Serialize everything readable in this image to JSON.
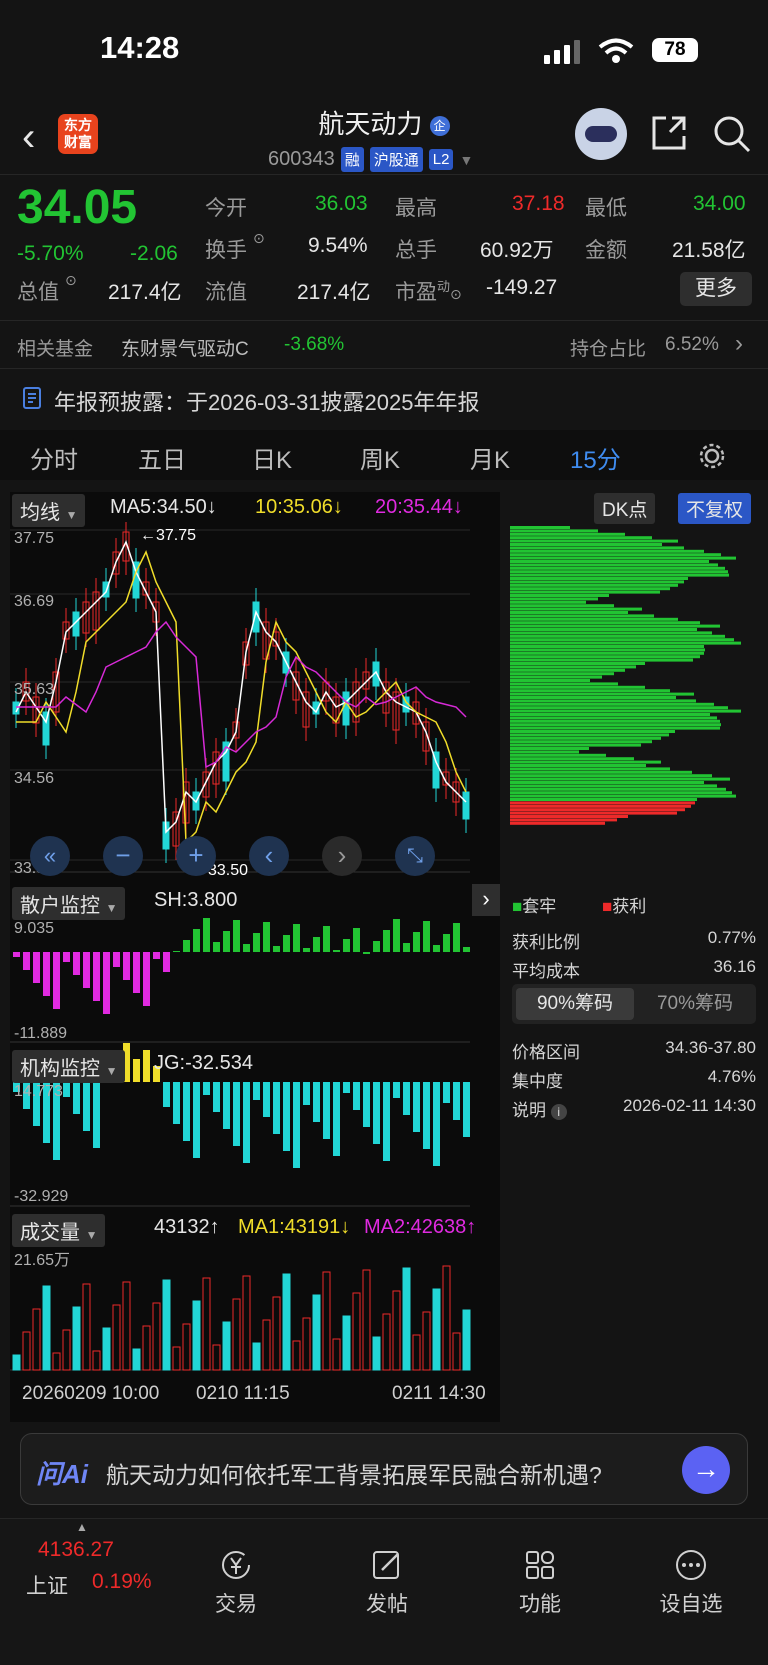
{
  "status": {
    "time": "14:28",
    "battery": "78"
  },
  "header": {
    "logo_text": "东方财富",
    "title": "航天动力",
    "title_badge": "企",
    "code": "600343",
    "tags": [
      "融",
      "沪股通",
      "L2"
    ]
  },
  "quote": {
    "price": "34.05",
    "change_pct": "-5.70%",
    "change": "-2.06",
    "open_label": "今开",
    "open": "36.03",
    "high_label": "最高",
    "high": "37.18",
    "low_label": "最低",
    "low": "34.00",
    "turnover_label": "换手",
    "turnover": "9.54%",
    "volume_label": "总手",
    "volume": "60.92万",
    "amount_label": "金额",
    "amount": "21.58亿",
    "mktcap_label": "总值",
    "mktcap": "217.4亿",
    "float_label": "流值",
    "float": "217.4亿",
    "pe_label": "市盈",
    "pe_sup": "动",
    "pe": "-149.27",
    "more": "更多"
  },
  "fund": {
    "label": "相关基金",
    "name": "东财景气驱动C",
    "change": "-3.68%",
    "hold_label": "持仓占比",
    "hold": "6.52%"
  },
  "notice": "年报预披露：于2026-03-31披露2025年年报",
  "tabs": [
    "分时",
    "五日",
    "日K",
    "周K",
    "月K",
    "15分"
  ],
  "active_tab": "15分",
  "chart": {
    "ma_selector": "均线",
    "ma5": "MA5:34.50",
    "ma10": "10:35.06",
    "ma20": "20:35.44",
    "dk_button": "DK点",
    "adjust_button": "不复权",
    "y_ticks": [
      "37.75",
      "36.69",
      "35.63",
      "34.56",
      "33.50"
    ],
    "high_mark": "37.75",
    "low_mark": "33.50",
    "retail_selector": "散户监控",
    "retail_value": "SH:3.800",
    "retail_max": "9.035",
    "retail_min": "-11.889",
    "inst_selector": "机构监控",
    "inst_value": "JG:-32.534",
    "inst_max": "14.773",
    "inst_min": "-32.929",
    "vol_selector": "成交量",
    "vol_value": "43132",
    "vol_ma1": "MA1:43191",
    "vol_ma2": "MA2:42638",
    "vol_max": "21.65万",
    "x_labels": [
      "20260209 10:00",
      "0210 11:15",
      "0211 14:30"
    ],
    "colors": {
      "up": "#ee2a2a",
      "down": "#22d6d6",
      "ma5": "#ffffff",
      "ma10": "#f0dd2a",
      "ma20": "#d72ad7"
    }
  },
  "chips": {
    "legend_trapped": "套牢",
    "legend_profit": "获利",
    "profit_ratio_label": "获利比例",
    "profit_ratio": "0.77%",
    "avg_cost_label": "平均成本",
    "avg_cost": "36.16",
    "tab90": "90%筹码",
    "tab70": "70%筹码",
    "range_label": "价格区间",
    "range": "34.36-37.80",
    "concentration_label": "集中度",
    "concentration": "4.76%",
    "note_label": "说明",
    "note_date": "2026-02-11 14:30"
  },
  "ai": {
    "brand": "问Ai",
    "prompt": "航天动力如何依托军工背景拓展军民融合新机遇?"
  },
  "nav": {
    "index_value": "4136.27",
    "index_name": "上证",
    "index_change": "0.19%",
    "items": [
      "交易",
      "发帖",
      "功能",
      "设自选"
    ]
  }
}
